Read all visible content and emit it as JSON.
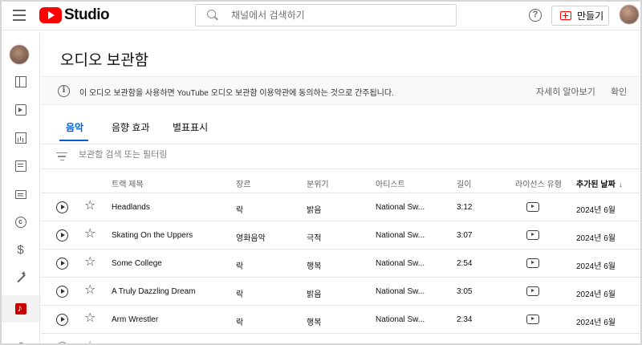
{
  "app": {
    "logo_text": "Studio",
    "search_placeholder": "채널에서 검색하기",
    "help_glyph": "?",
    "create_label": "만들기"
  },
  "page": {
    "title": "오디오 보관함",
    "notice": {
      "text": "이 오디오 보관함을 사용하면 YouTube 오디오 보관함 이용약관에 동의하는 것으로 간주됩니다.",
      "learn_more": "자세히 알아보기",
      "confirm": "확인"
    },
    "tabs": [
      {
        "label": "음악",
        "active": true
      },
      {
        "label": "음향 효과",
        "active": false
      },
      {
        "label": "별표표시",
        "active": false
      }
    ],
    "filter_placeholder": "보관함 검색 또는 필터링"
  },
  "table": {
    "headers": {
      "title": "트랙 제목",
      "genre": "장르",
      "mood": "분위기",
      "artist": "아티스트",
      "duration": "길이",
      "license": "라이선스 유형",
      "added": "추가된 날짜",
      "sort_indicator": "↓"
    },
    "rows": [
      {
        "title": "Headlands",
        "genre": "락",
        "mood": "밝음",
        "artist": "National Sw...",
        "duration": "3:12",
        "added": "2024년 6월"
      },
      {
        "title": "Skating On the Uppers",
        "genre": "영화음악",
        "mood": "극적",
        "artist": "National Sw...",
        "duration": "3:07",
        "added": "2024년 6월"
      },
      {
        "title": "Some College",
        "genre": "락",
        "mood": "행복",
        "artist": "National Sw...",
        "duration": "2:54",
        "added": "2024년 6월"
      },
      {
        "title": "A Truly Dazzling Dream",
        "genre": "락",
        "mood": "밝음",
        "artist": "National Sw...",
        "duration": "3:05",
        "added": "2024년 6월"
      },
      {
        "title": "Arm Wrestler",
        "genre": "락",
        "mood": "행복",
        "artist": "National Sw...",
        "duration": "2:34",
        "added": "2024년 6월"
      }
    ]
  },
  "icons": {
    "menu": "hamburger-menu-icon",
    "search": "search-icon",
    "help": "help-icon",
    "create": "create-video-icon",
    "info": "info-icon",
    "filter": "filter-icon",
    "play": "play-circle-icon",
    "star": "star-outline-icon",
    "license": "youtube-license-icon"
  },
  "colors": {
    "brand_red": "#ff0000",
    "accent_blue": "#065fd4",
    "audio_library_active": "#cc0000"
  }
}
